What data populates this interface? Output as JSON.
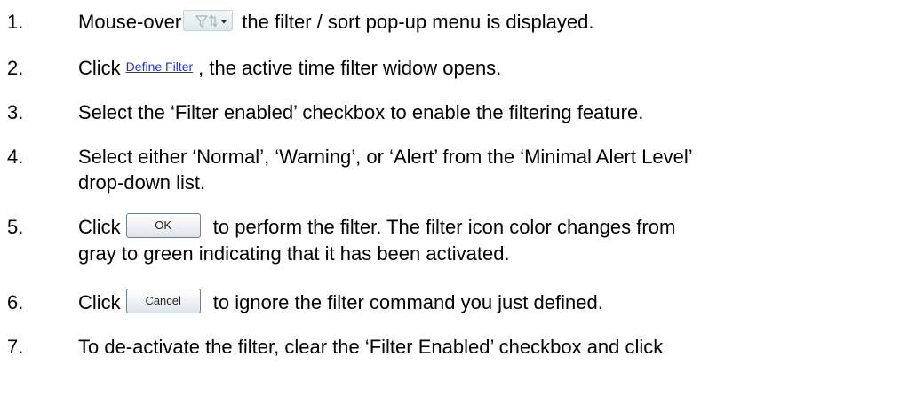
{
  "steps": [
    {
      "number": "1.",
      "before": "Mouse-over",
      "widget_icon": "filter-sort-icon",
      "after": "the filter / sort pop-up menu is displayed."
    },
    {
      "number": "2.",
      "before": "Click",
      "link_label": "Define Filter",
      "after": ", the active time filter widow opens."
    },
    {
      "number": "3.",
      "line1": "Select the ‘Filter enabled’ checkbox to enable the filtering feature."
    },
    {
      "number": "4.",
      "line1": "Select either ‘Normal’, ‘Warning’, or ‘Alert’ from the ‘Minimal Alert Level’",
      "line2": "drop-down list."
    },
    {
      "number": "5.",
      "before": "Click",
      "button_label": "OK",
      "after": "to perform the filter. The filter icon color changes from",
      "line2": "gray to green indicating that it has been activated."
    },
    {
      "number": "6.",
      "before": "Click",
      "button_label": "Cancel",
      "after": "to ignore the filter command you just defined."
    },
    {
      "number": "7.",
      "line1": "To de-activate the filter, clear the ‘Filter Enabled’ checkbox and click"
    }
  ],
  "colors": {
    "link": "#1a33d6",
    "widget_border": "#c7d3d8",
    "button_border": "#6f7f8c"
  }
}
